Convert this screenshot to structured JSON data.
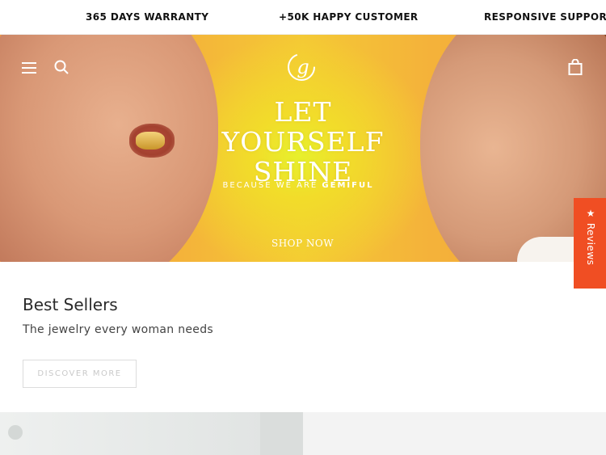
{
  "announcement": {
    "items": [
      "365 DAYS WARRANTY",
      "+50K HAPPY CUSTOMER",
      "RESPONSIVE SUPPORT"
    ]
  },
  "header": {
    "icons": [
      "menu-icon",
      "search-icon",
      "shopping-bag-icon"
    ],
    "logo_letter": "g"
  },
  "hero": {
    "title_lines": [
      "LET",
      "YOURSELF",
      "SHINE"
    ],
    "subtitle_prefix": "BECAUSE WE ARE",
    "subtitle_brand": "GEMIFUL",
    "cta": "SHOP NOW"
  },
  "reviews_tab": {
    "label": "★ Reviews",
    "color": "#f04e23"
  },
  "best_sellers": {
    "title": "Best Sellers",
    "subtitle": "The jewelry every woman needs",
    "button": "DISCOVER MORE"
  }
}
